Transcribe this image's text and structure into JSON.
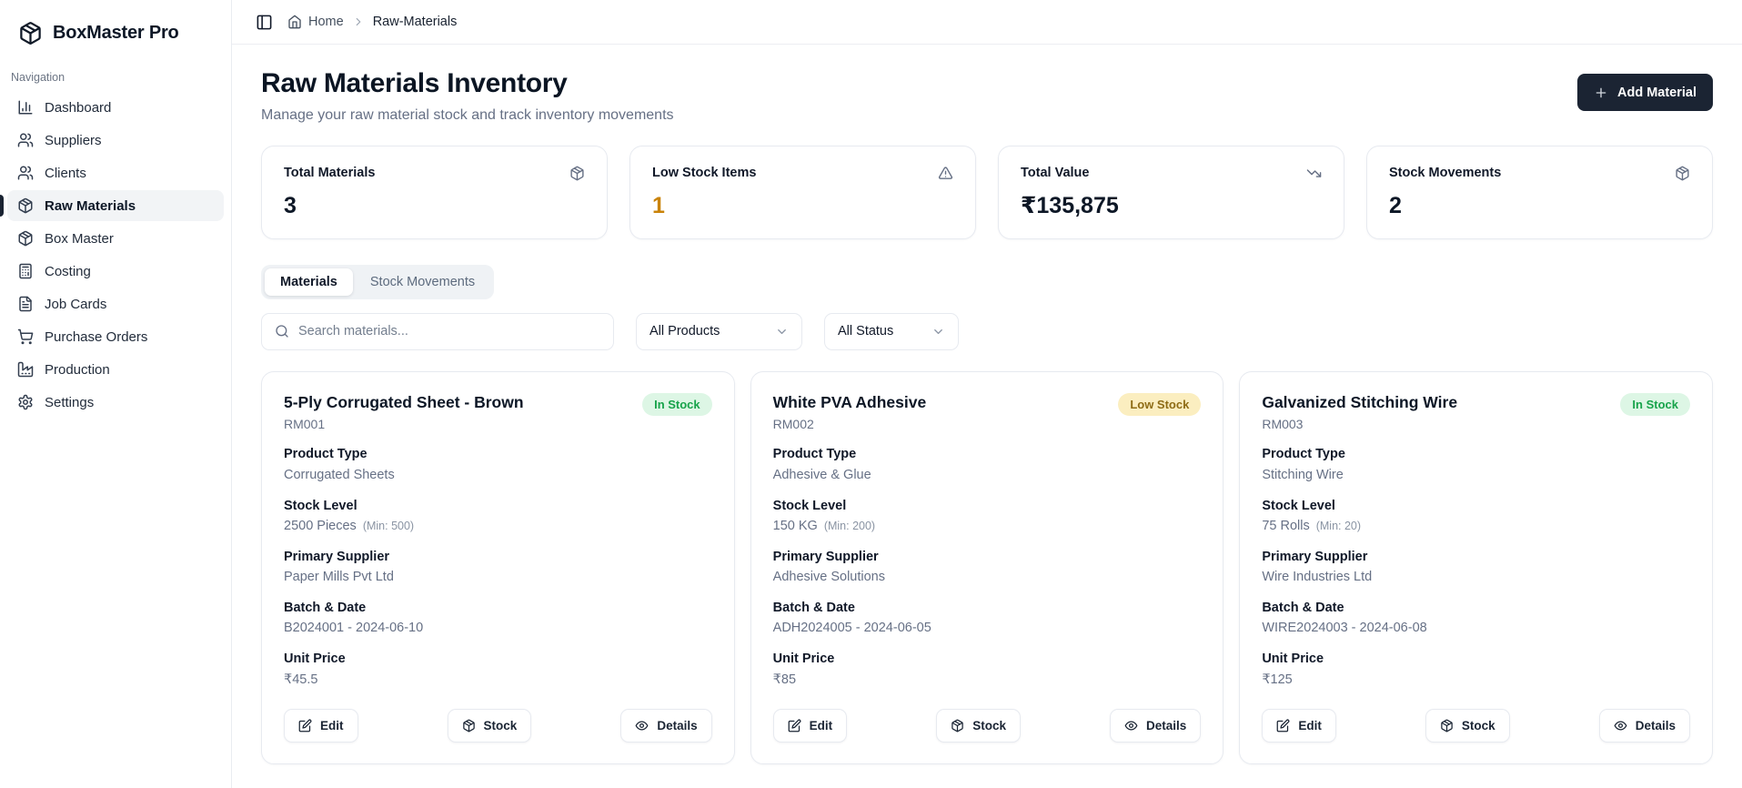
{
  "app": {
    "name": "BoxMaster Pro",
    "logo_icon": "package"
  },
  "sidebar": {
    "section_label": "Navigation",
    "items": [
      {
        "label": "Dashboard",
        "icon": "bar-chart",
        "active": false
      },
      {
        "label": "Suppliers",
        "icon": "users",
        "active": false
      },
      {
        "label": "Clients",
        "icon": "users",
        "active": false
      },
      {
        "label": "Raw Materials",
        "icon": "package",
        "active": true
      },
      {
        "label": "Box Master",
        "icon": "package",
        "active": false
      },
      {
        "label": "Costing",
        "icon": "calculator",
        "active": false
      },
      {
        "label": "Job Cards",
        "icon": "file-text",
        "active": false
      },
      {
        "label": "Purchase Orders",
        "icon": "shopping-cart",
        "active": false
      },
      {
        "label": "Production",
        "icon": "factory",
        "active": false
      },
      {
        "label": "Settings",
        "icon": "settings",
        "active": false
      }
    ]
  },
  "breadcrumb": {
    "home": "Home",
    "current": "Raw-Materials"
  },
  "header": {
    "title": "Raw Materials Inventory",
    "subtitle": "Manage your raw material stock and track inventory movements",
    "add_button_label": "Add Material"
  },
  "stats": [
    {
      "label": "Total Materials",
      "value": "3",
      "icon": "package",
      "tone": "default"
    },
    {
      "label": "Low Stock Items",
      "value": "1",
      "icon": "alert-triangle",
      "tone": "amber"
    },
    {
      "label": "Total Value",
      "value": "₹135,875",
      "icon": "trending-down",
      "tone": "default"
    },
    {
      "label": "Stock Movements",
      "value": "2",
      "icon": "package",
      "tone": "default"
    }
  ],
  "tabs": [
    {
      "label": "Materials",
      "active": true
    },
    {
      "label": "Stock Movements",
      "active": false
    }
  ],
  "filters": {
    "search_placeholder": "Search materials...",
    "product_filter_value": "All Products",
    "status_filter_value": "All Status"
  },
  "card_labels": {
    "product_type": "Product Type",
    "stock_level": "Stock Level",
    "primary_supplier": "Primary Supplier",
    "batch_date": "Batch & Date",
    "unit_price": "Unit Price"
  },
  "card_actions": {
    "edit": "Edit",
    "stock": "Stock",
    "details": "Details"
  },
  "materials": [
    {
      "name": "5-Ply Corrugated Sheet - Brown",
      "code": "RM001",
      "status": "In Stock",
      "status_type": "in-stock",
      "product_type": "Corrugated Sheets",
      "stock_level": "2500 Pieces",
      "stock_min": "(Min: 500)",
      "primary_supplier": "Paper Mills Pvt Ltd",
      "batch_date": "B2024001 - 2024-06-10",
      "unit_price": "₹45.5"
    },
    {
      "name": "White PVA Adhesive",
      "code": "RM002",
      "status": "Low Stock",
      "status_type": "low-stock",
      "product_type": "Adhesive & Glue",
      "stock_level": "150 KG",
      "stock_min": "(Min: 200)",
      "primary_supplier": "Adhesive Solutions",
      "batch_date": "ADH2024005 - 2024-06-05",
      "unit_price": "₹85"
    },
    {
      "name": "Galvanized Stitching Wire",
      "code": "RM003",
      "status": "In Stock",
      "status_type": "in-stock",
      "product_type": "Stitching Wire",
      "stock_level": "75 Rolls",
      "stock_min": "(Min: 20)",
      "primary_supplier": "Wire Industries Ltd",
      "batch_date": "WIRE2024003 - 2024-06-08",
      "unit_price": "₹125"
    }
  ],
  "colors": {
    "accent_dark": "#1b2433",
    "amber_value": "#c9830a",
    "in_stock_bg": "#ddf6e5",
    "in_stock_text": "#17a34a",
    "low_stock_bg": "#fbeec0",
    "low_stock_text": "#8e6c15"
  }
}
